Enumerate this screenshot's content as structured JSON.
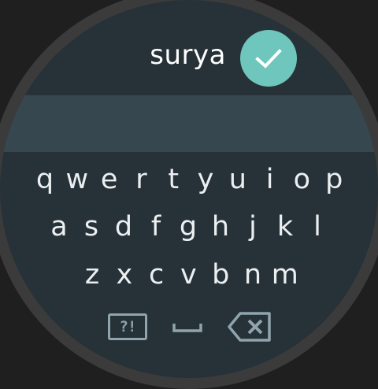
{
  "input": {
    "text": "surya"
  },
  "confirm": {
    "icon": "check-icon",
    "color": "#6fc6bc"
  },
  "keyboard": {
    "rows": [
      [
        "q",
        "w",
        "e",
        "r",
        "t",
        "y",
        "u",
        "i",
        "o",
        "p"
      ],
      [
        "a",
        "s",
        "d",
        "f",
        "g",
        "h",
        "j",
        "k",
        "l"
      ],
      [
        "z",
        "x",
        "c",
        "v",
        "b",
        "n",
        "m"
      ]
    ],
    "symbols_label": "?!",
    "space_icon": "space-icon",
    "delete_icon": "backspace-icon"
  },
  "colors": {
    "face_background": "#263238",
    "suggestion_strip": "#37474f",
    "key_text": "#eceff1",
    "function_key": "#90a4ae"
  }
}
